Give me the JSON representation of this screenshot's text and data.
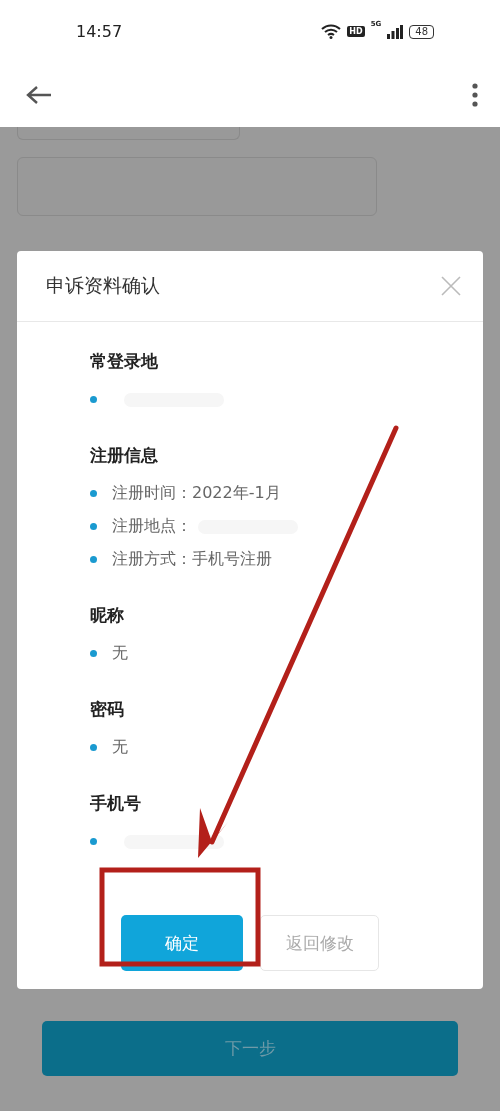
{
  "status_bar": {
    "time": "14:57",
    "hd": "HD",
    "network": "5G",
    "battery": "48"
  },
  "dialog": {
    "title": "申诉资料确认",
    "sections": [
      {
        "heading": "常登录地",
        "items": [
          {
            "redacted": true
          }
        ]
      },
      {
        "heading": "注册信息",
        "items": [
          {
            "text": "注册时间：2022年-1月",
            "redacted": false
          },
          {
            "text": "注册地点：",
            "redacted": true
          },
          {
            "text": "注册方式：手机号注册",
            "redacted": false
          }
        ]
      },
      {
        "heading": "昵称",
        "items": [
          {
            "text": "无",
            "redacted": false
          }
        ]
      },
      {
        "heading": "密码",
        "items": [
          {
            "text": "无",
            "redacted": false
          }
        ]
      },
      {
        "heading": "手机号",
        "items": [
          {
            "redacted": true
          }
        ]
      }
    ],
    "buttons": [
      {
        "label": "确定",
        "kind": "primary"
      },
      {
        "label": "返回修改",
        "kind": "secondary"
      }
    ]
  },
  "next_button": {
    "label": "下一步",
    "disabled": true
  }
}
